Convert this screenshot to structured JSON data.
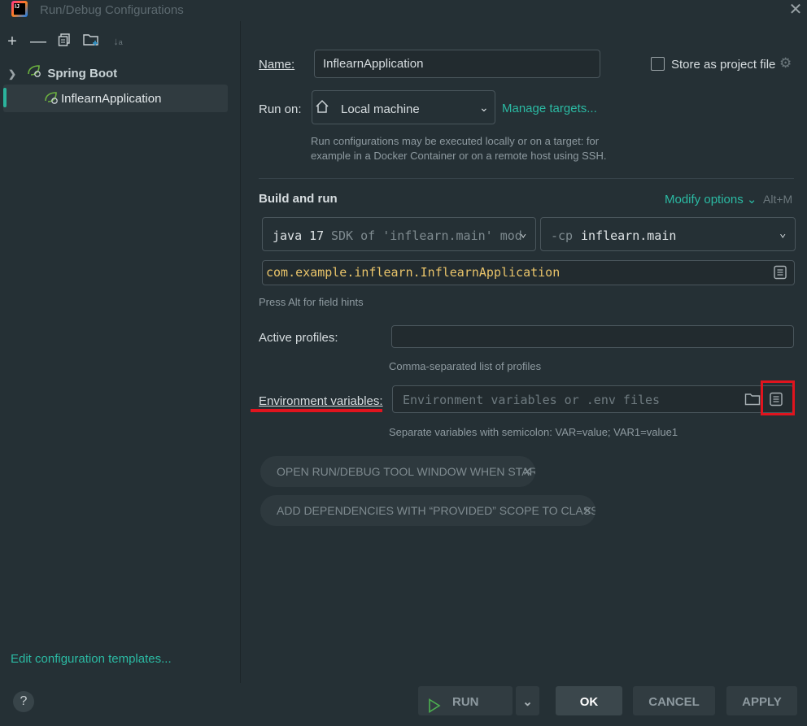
{
  "window": {
    "title": "Run/Debug Configurations",
    "logo_text": "IJ"
  },
  "toolbar": {
    "icons": [
      "plus-icon",
      "minus-icon",
      "copy-icon",
      "new-folder-icon",
      "sort-icon"
    ]
  },
  "tree": {
    "group_label": "Spring Boot",
    "items": [
      {
        "label": "InflearnApplication",
        "selected": true
      }
    ]
  },
  "left_footer": {
    "edit_templates_link": "Edit configuration templates...",
    "help_label": "?"
  },
  "form": {
    "name_label": "Name:",
    "name_value": "InflearnApplication",
    "store_as_project_file_label": "Store as project file",
    "store_as_project_file_checked": false,
    "run_on_label": "Run on:",
    "run_on_value": "Local machine",
    "manage_targets_link": "Manage targets...",
    "run_on_hint_line1": "Run configurations may be executed locally or on a target: for",
    "run_on_hint_line2": "example in a Docker Container or on a remote host using SSH.",
    "build_and_run_label": "Build and run",
    "modify_options_link": "Modify options",
    "modify_options_shortcut": "Alt+M",
    "jdk_version": "java 17",
    "jdk_detail": "SDK of 'inflearn.main' modu",
    "classpath_prefix": "-cp",
    "classpath_value": "inflearn.main",
    "main_class_value": "com.example.inflearn.InflearnApplication",
    "field_hints_text": "Press Alt for field hints",
    "active_profiles_label": "Active profiles:",
    "active_profiles_value": "",
    "active_profiles_hint": "Comma-separated list of profiles",
    "env_vars_label": "Environment variables:",
    "env_vars_placeholder": "Environment variables or .env files",
    "env_vars_hint": "Separate variables with semicolon: VAR=value; VAR1=value1",
    "option_pills": [
      "OPEN RUN/DEBUG TOOL WINDOW WHEN STARTED",
      "ADD DEPENDENCIES WITH “PROVIDED” SCOPE TO CLASSPATH"
    ]
  },
  "annotation": {
    "highlight_color": "#e0141e"
  },
  "buttons": {
    "run": "RUN",
    "ok": "OK",
    "cancel": "CANCEL",
    "apply": "APPLY"
  },
  "colors": {
    "accent": "#2bbaa3",
    "background": "#253035",
    "main_class_text": "#e9c46a"
  }
}
